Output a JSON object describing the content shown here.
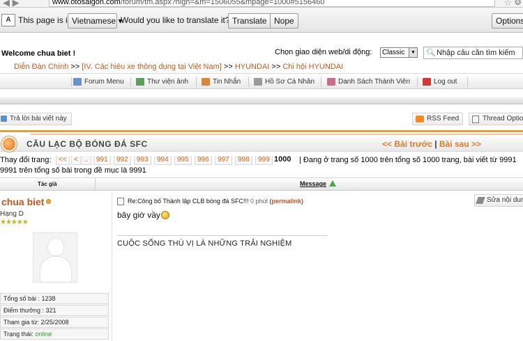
{
  "browser": {
    "url_host": "www.otosaigon.com",
    "url_rest": "/forum/tm.aspx?high=&m=1506055&mpage=1000#5156460"
  },
  "translate_bar": {
    "prefix": "This page is in",
    "language": "Vietnamese",
    "question": "Would you like to translate it?",
    "translate_label": "Translate",
    "nope_label": "Nope",
    "options_label": "Options"
  },
  "header": {
    "welcome": "Welcome chua biet !",
    "chooser_label": "Chọn giao diện web/di động:",
    "chooser_value": "Classic",
    "search_placeholder": "Nhập câu cần tìm kiếm"
  },
  "breadcrumb": {
    "items": [
      "Diễn Đàn Chính",
      "[IV. Các hiệu xe thông dụng tại Việt Nam]",
      "HYUNDAI",
      "Chi hội HYUNDAI"
    ],
    "sep": ">>"
  },
  "menu": {
    "items": [
      "Forum Menu",
      "Thư viện ảnh",
      "Tin Nhắn",
      "Hồ Sơ Cá Nhân",
      "Danh Sách Thành Viên",
      "Log out"
    ]
  },
  "actions": {
    "reply": "Trả lời bài viết này",
    "rss": "RSS Feed",
    "thread_options": "Thread Options"
  },
  "topic": {
    "title": "CÂU LẠC BỘ BÓNG ĐÁ SFC",
    "prev": "<< Bài trước",
    "next": "Bài sau >>",
    "bar": "|"
  },
  "pager": {
    "label": "Thay đổi trang:",
    "first": "<<",
    "prev": "<",
    "dots": "..",
    "pages": [
      "991",
      "992",
      "993",
      "994",
      "995",
      "996",
      "997",
      "998",
      "999"
    ],
    "current": "1000",
    "info": "| Đang ở trang số 1000 trên tổng số 1000 trang, bài viết từ 9991",
    "info2": "9991 trên tổng số bài trong đề mục là 9991"
  },
  "columns": {
    "author": "Tác giả",
    "message": "Message"
  },
  "user": {
    "name": "chua biet",
    "rank": "Hạng D",
    "stars": "★★★★★",
    "stats": [
      {
        "label": "Tổng số bài : 1238"
      },
      {
        "label": "Điểm thưởng : 321"
      },
      {
        "label": "Tham gia từ: 2/25/2008"
      }
    ],
    "status_label": "Trạng thái:",
    "status_value": "online"
  },
  "post": {
    "title": "Re:Công bố Thành lập CLB bóng đá SFC!!!",
    "time": "0 phút",
    "permalink": "permalink",
    "body": "bây giờ vầy",
    "signature": "CUỘC SỐNG THÚ VỊ LÀ NHỮNG TRẢI NGHIỆM",
    "edit_label": "Sửa nội dung"
  },
  "colors": {
    "accent_orange": "#e0782a",
    "link_orange": "#c8581a",
    "online_green": "#2a9a2a"
  }
}
